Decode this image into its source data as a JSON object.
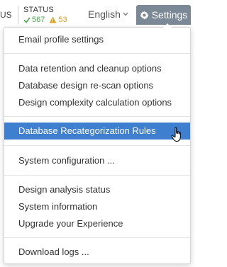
{
  "topbar": {
    "left_fragment": "US",
    "status": {
      "label": "STATUS",
      "ok_count": "567",
      "warning_count": "53",
      "ok_icon": "checkmark-icon",
      "warning_icon": "warning-triangle-icon"
    },
    "language": "English",
    "language_icon": "chevron-down-icon",
    "settings_label": "Settings",
    "settings_icon": "gear-icon"
  },
  "menu": {
    "items": [
      "Email profile settings",
      "Data retention and cleanup options",
      "Database design re-scan options",
      "Design complexity calculation options",
      "Database Recategorization Rules",
      "System configuration ...",
      "Design analysis status",
      "System information",
      "Upgrade your Experience",
      "Download logs ..."
    ],
    "highlighted": "Database Recategorization Rules"
  },
  "colors": {
    "settings_button_bg": "#7b8896",
    "highlight_bg": "#3f7fd0",
    "ok": "#4aa74a",
    "warning": "#e0a020"
  }
}
